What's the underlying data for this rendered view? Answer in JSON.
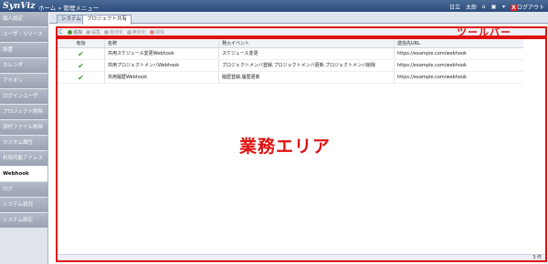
{
  "header": {
    "logo": "SynViz",
    "breadcrumb": [
      "ホーム",
      "管理メニュー"
    ],
    "separator": "»",
    "user": "日立　太郎",
    "logout_label": "ログアウト",
    "logout_icon": "X"
  },
  "sidebar": {
    "items": [
      {
        "label": "個人設定"
      },
      {
        "label": "ユーザ・リソース"
      },
      {
        "label": "設置"
      },
      {
        "label": "カレンダ"
      },
      {
        "label": "アドオン"
      },
      {
        "label": "ログインユーザ"
      },
      {
        "label": "プロジェクト削除"
      },
      {
        "label": "添付ファイル削除"
      },
      {
        "label": "カスタム属性"
      },
      {
        "label": "利用可能アドレス"
      },
      {
        "label": "Webhook"
      },
      {
        "label": "ログ"
      },
      {
        "label": "システム状況"
      },
      {
        "label": "システム設定"
      }
    ],
    "active_index": 10
  },
  "tabs": [
    {
      "label": "システム"
    },
    {
      "label": "プロジェクト共有"
    }
  ],
  "toolbar": {
    "refresh_icon": "C",
    "add_label": "追加",
    "edit_label": "編集",
    "enable_label": "有効化",
    "disable_label": "無効化",
    "delete_label": "削除",
    "annotation": "ツールバー"
  },
  "area_annotation": "業務エリア",
  "table": {
    "columns": [
      "有効",
      "名称",
      "発火イベント",
      "送信先URL"
    ],
    "rows": [
      {
        "enabled": "✔",
        "name": "共用スケジュール変更Webhook",
        "event": "スケジュール変更",
        "url": "https://example.com/webhook"
      },
      {
        "enabled": "✔",
        "name": "共用プロジェクトメンバWebhook",
        "event": "プロジェクトメンバ登録,プロジェクトメンバ更新,プロジェクトメンバ削除",
        "url": "https://example.com/webhook"
      },
      {
        "enabled": "✔",
        "name": "共用履歴Webhook",
        "event": "履歴登録,履歴更新",
        "url": "https://example.com/webhook"
      }
    ]
  },
  "status": {
    "count": "3 件"
  },
  "colors": {
    "accent_red": "#e01010",
    "header_blue": "#2c4c7c",
    "check_green": "#3f9a2e"
  }
}
